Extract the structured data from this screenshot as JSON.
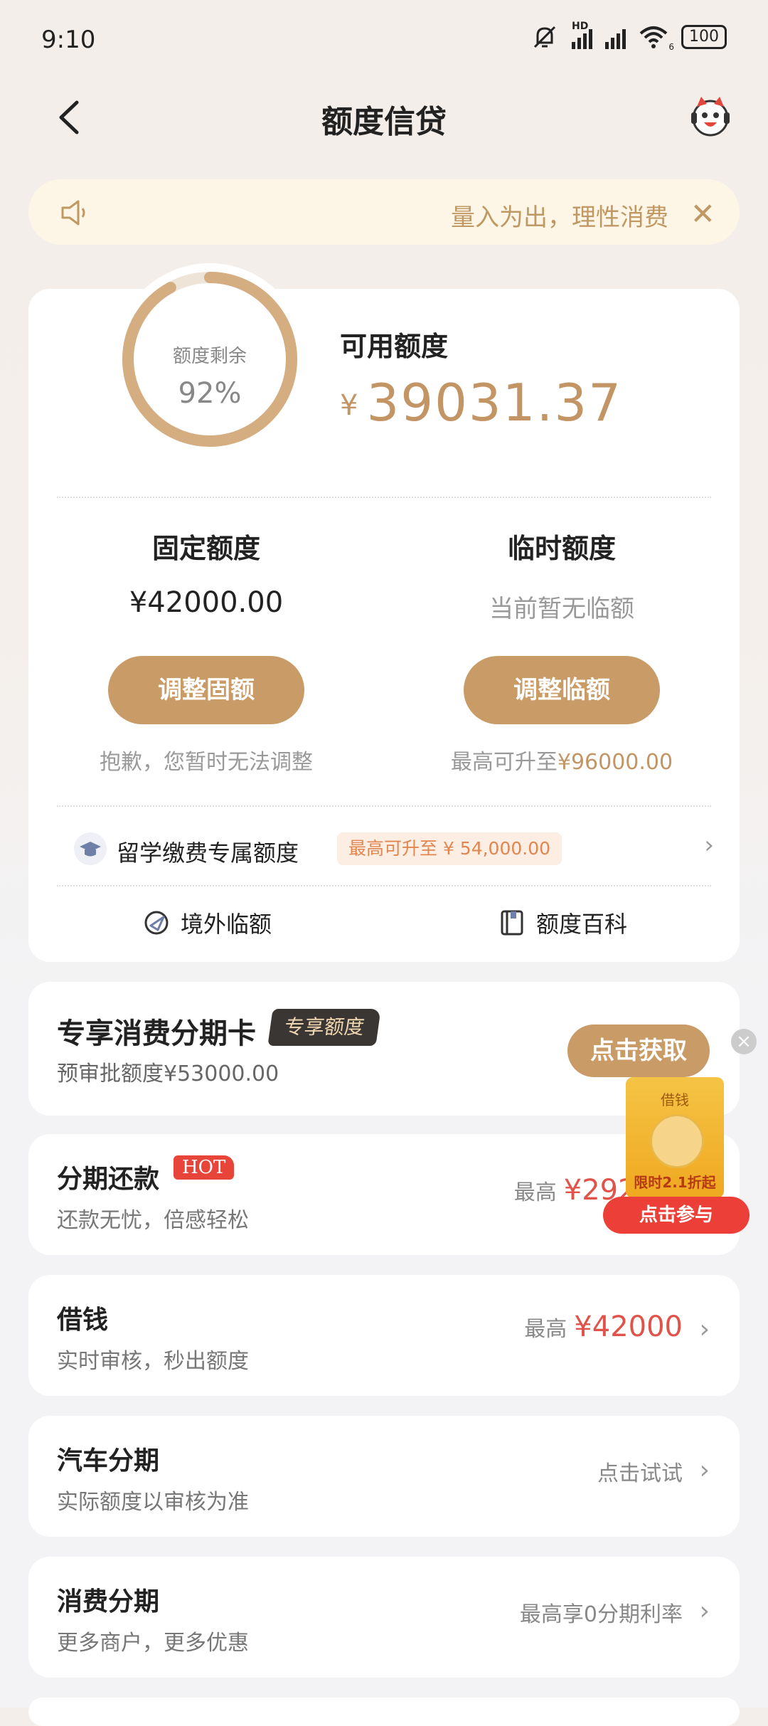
{
  "status_bar": {
    "time": "9:10",
    "signal_1": "HD",
    "wifi_sub": "6",
    "battery": "100"
  },
  "header": {
    "title": "额度信贷"
  },
  "notice": {
    "text": "量入为出，理性消费"
  },
  "summary": {
    "ring_label": "额度剩余",
    "ring_percent_text": "92%",
    "ring_fraction": 0.92,
    "available_label": "可用额度",
    "available_currency": "¥",
    "available_amount": "39031.37"
  },
  "fixed": {
    "title": "固定额度",
    "amount": "¥42000.00",
    "button": "调整固额",
    "note": "抱歉，您暂时无法调整"
  },
  "temp": {
    "title": "临时额度",
    "status": "当前暂无临额",
    "button": "调整临额",
    "note_prefix": "最高可升至",
    "note_amount": "¥96000.00"
  },
  "study": {
    "label": "留学缴费专属额度",
    "badge": "最高可升至 ¥ 54,000.00"
  },
  "shortcuts": {
    "overseas": "境外临额",
    "encyclopedia": "额度百科"
  },
  "exclusive": {
    "title": "专享消费分期卡",
    "badge": "专享额度",
    "sub": "预审批额度¥53000.00",
    "button": "点击获取"
  },
  "list": [
    {
      "title": "分期还款",
      "tag": "HOT",
      "sub": "还款无忧，倍感轻松",
      "right_prefix": "最高",
      "right_value": "¥2928"
    },
    {
      "title": "借钱",
      "sub": "实时审核，秒出额度",
      "right_prefix": "最高",
      "right_value": "¥42000"
    },
    {
      "title": "汽车分期",
      "sub": "实际额度以审核为准",
      "right_text": "点击试试"
    },
    {
      "title": "消费分期",
      "sub": "更多商户，更多优惠",
      "right_text": "最高享0分期利率"
    }
  ],
  "promo": {
    "envelope_title": "借钱",
    "envelope_text": "限时2.1折起",
    "button": "点击参与",
    "close": "×"
  },
  "colors": {
    "gold": "#c99b67",
    "red": "#e0534a",
    "notice_bg": "#fdf6e6"
  }
}
